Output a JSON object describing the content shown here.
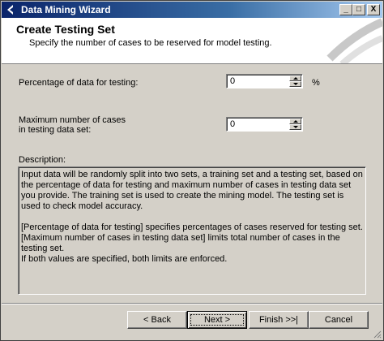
{
  "window": {
    "title": "Data Mining Wizard",
    "controls": {
      "minimize": "_",
      "maximize": "□",
      "close": "X"
    }
  },
  "header": {
    "title": "Create Testing Set",
    "subtitle": "Specify the number of cases to be reserved for model testing."
  },
  "fields": {
    "percentage": {
      "label": "Percentage of data for testing:",
      "value": "0",
      "unit": "%"
    },
    "max_cases": {
      "label_line1": "Maximum number of cases",
      "label_line2": "in testing data set:",
      "value": "0"
    }
  },
  "description": {
    "label": "Description:",
    "paragraph1": "Input data will be randomly split into two sets, a training set and a testing set, based on the percentage of data for testing and maximum number of cases in testing data set you provide. The training set is used to create the mining model. The testing set is used to check model accuracy.",
    "line1": "[Percentage of data for testing] specifies percentages of cases reserved for testing set.",
    "line2": "[Maximum number of cases in testing data set] limits total number of cases in the testing set.",
    "line3": "If both values are specified, both limits are enforced."
  },
  "buttons": {
    "back": "< Back",
    "next": "Next >",
    "finish": "Finish >>|",
    "cancel": "Cancel"
  },
  "colors": {
    "titlebar": "#0a246a",
    "dialog": "#d4d0c8"
  },
  "icons": [
    "wizard-app-icon",
    "header-swoosh-art",
    "spin-up-icon",
    "spin-down-icon",
    "resize-grip-icon"
  ]
}
